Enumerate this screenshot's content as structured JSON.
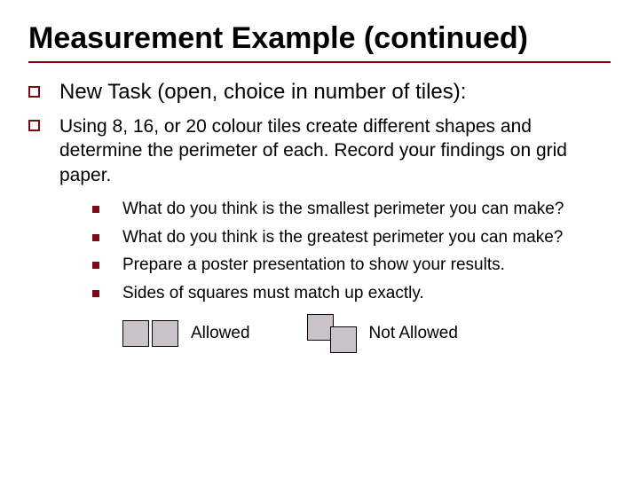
{
  "title": "Measurement Example (continued)",
  "lvl1": {
    "text": "New Task (open, choice in number of tiles):"
  },
  "lvl2": {
    "text": "Using 8, 16, or 20 colour tiles create different shapes and determine the perimeter of each. Record your findings on grid paper."
  },
  "sub": [
    "What do you think is the smallest perimeter you can make?",
    "What do you think is the greatest perimeter you can make?",
    "Prepare a poster presentation to show your results.",
    "Sides of squares must match up exactly."
  ],
  "allowed_label": "Allowed",
  "not_allowed_label": "Not Allowed"
}
